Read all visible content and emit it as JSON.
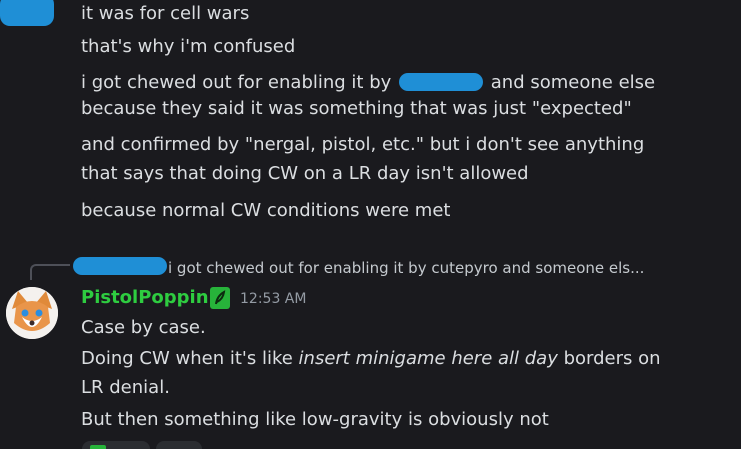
{
  "prev_messages": [
    "it was for cell wars",
    "that's why i'm confused",
    "because normal CW conditions were met"
  ],
  "long_message": {
    "line1_before": "i got chewed out for enabling it by",
    "line1_after": "and someone else",
    "line2": "because they said it was something that was just \"expected\"",
    "line3": "and confirmed by \"nergal, pistol, etc.\" but i don't see anything",
    "line4": "that says that doing CW on a LR day isn't allowed"
  },
  "reply": {
    "preview_text": "i got chewed out for enabling it by cutepyro and someone els..."
  },
  "author": {
    "username": "PistolPoppin",
    "timestamp": "12:53 AM",
    "badge_icon": "role-leaf-icon",
    "name_color": "#2ecc40"
  },
  "reply_message": {
    "line1": "Case by case.",
    "line2_before": "Doing CW when it's like ",
    "line2_italic": "insert minigame here all day",
    "line2_after": " borders on",
    "line3": "LR denial.",
    "line4": "But then something like low-gravity is obviously not"
  },
  "colors": {
    "background": "#1a1a1e",
    "text": "#dbdee1",
    "redaction": "#1f8fd6",
    "muted": "#949ba4"
  }
}
